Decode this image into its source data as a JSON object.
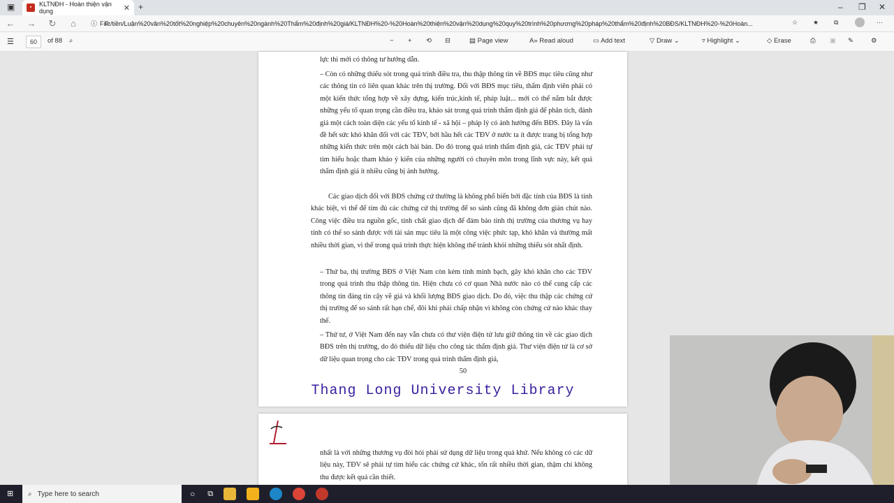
{
  "tab": {
    "title": "KLTNĐH - Hoàn thiện vận dụng"
  },
  "address": {
    "protocol": "File",
    "url": "F:/tiền/Luận%20văn%20tốt%20nghiệp%20chuyên%20ngành%20Thẩm%20định%20giá/KLTNĐH%20-%20Hoàn%20thiện%20vận%20dụng%20quy%20trình%20phương%20pháp%20thẩm%20định%20BĐS/KLTNĐH%20-%20Hoàn..."
  },
  "pdf_toolbar": {
    "page_number": "60",
    "page_total": "of 88",
    "page_view": "Page view",
    "read_aloud": "Read aloud",
    "add_text": "Add text",
    "draw": "Draw",
    "highlight": "Highlight",
    "erase": "Erase"
  },
  "page1": {
    "p0": "lực thì mới có thông tư hướng dẫn.",
    "p1": "– Còn có những thiếu sót trong quá trình điều tra, thu thập thông tin về BĐS mục tiêu cũng như các thông tin có liên quan khác trên thị trường. Đối với BĐS mục tiêu, thẩm định viên phải có một kiến thức tổng hợp về xây dựng, kiến trúc,kinh tế, pháp luật... mới có thể nắm bắt được những yếu tố quan trọng cần điều tra, khảo sát trong quá trình thẩm định giá để phân tích, đánh giá một cách toàn diện các yếu tố kinh tế - xã hội – pháp lý có ảnh hưởng đến BĐS. Đây là vấn đề hết sức khó khăn đối với các TĐV, bởi hầu hết các TĐV ở nước ta ít được trang bị tổng hợp những kiến thức trên một cách bài bản. Do đó trong quá trình thẩm định giá, các TĐV phải tự tìm hiểu hoặc tham khảo ý kiến của những người có chuyên môn trong lĩnh vực này, kết quả thẩm định giá ít nhiều cũng bị ảnh hưởng.",
    "p2": "Các giao dịch đối với BĐS chứng cứ thường là không phổ biến bởi đặc tính của BĐS là tính khác biệt, vì thế để tìm đủ các chứng cứ thị trường để so sánh cũng đã không đơn giản chút nào. Công việc điều tra nguồn gốc, tính chất giao dịch để đảm bảo tính thị trường của thương vụ hay tính có thể so sánh được với tài sản mục tiêu là một công việc phức tạp, khó khăn và thường mất nhiều thời gian, vì thế trong quá trình thực hiện không thể tránh khỏi những thiếu sót nhất định.",
    "p3": "– Thứ ba, thị trường BĐS ở Việt Nam còn kém tính minh bạch, gây khó khăn cho các TĐV trong quá trình thu thập thông tin. Hiện chưa có cơ quan Nhà nước nào có thể cung cấp các thông tin đáng tin cậy về giá và khối lượng BĐS giao dịch. Do đó, việc thu thập các chứng cứ thị trường để so sánh rất hạn chế, đôi khi phải chấp nhận vì không còn chứng cứ nào khác thay thế.",
    "p4": "– Thứ tư, ở Việt Nam đến nay vẫn chưa có thư viện điện tử lưu giữ thông tin về các giao dịch BĐS trên thị trường, do đó thiếu dữ liệu cho công tác thẩm định giá. Thư viện điện tử là cơ sở dữ liệu quan trọng cho các TĐV trong quá trình thẩm định giá,",
    "page_num": "50",
    "watermark": "Thang Long University Library"
  },
  "page2": {
    "p1": "nhất là với những thương vụ đòi hỏi phải sử dụng dữ liệu trong quá khứ. Nếu không có các dữ liệu này, TĐV sẽ phải tự tìm hiểu các chứng cứ khác, tốn rất nhiều thời gian, thậm chí không thu được kết quả cần thiết."
  },
  "taskbar": {
    "search": "Type here to search"
  }
}
